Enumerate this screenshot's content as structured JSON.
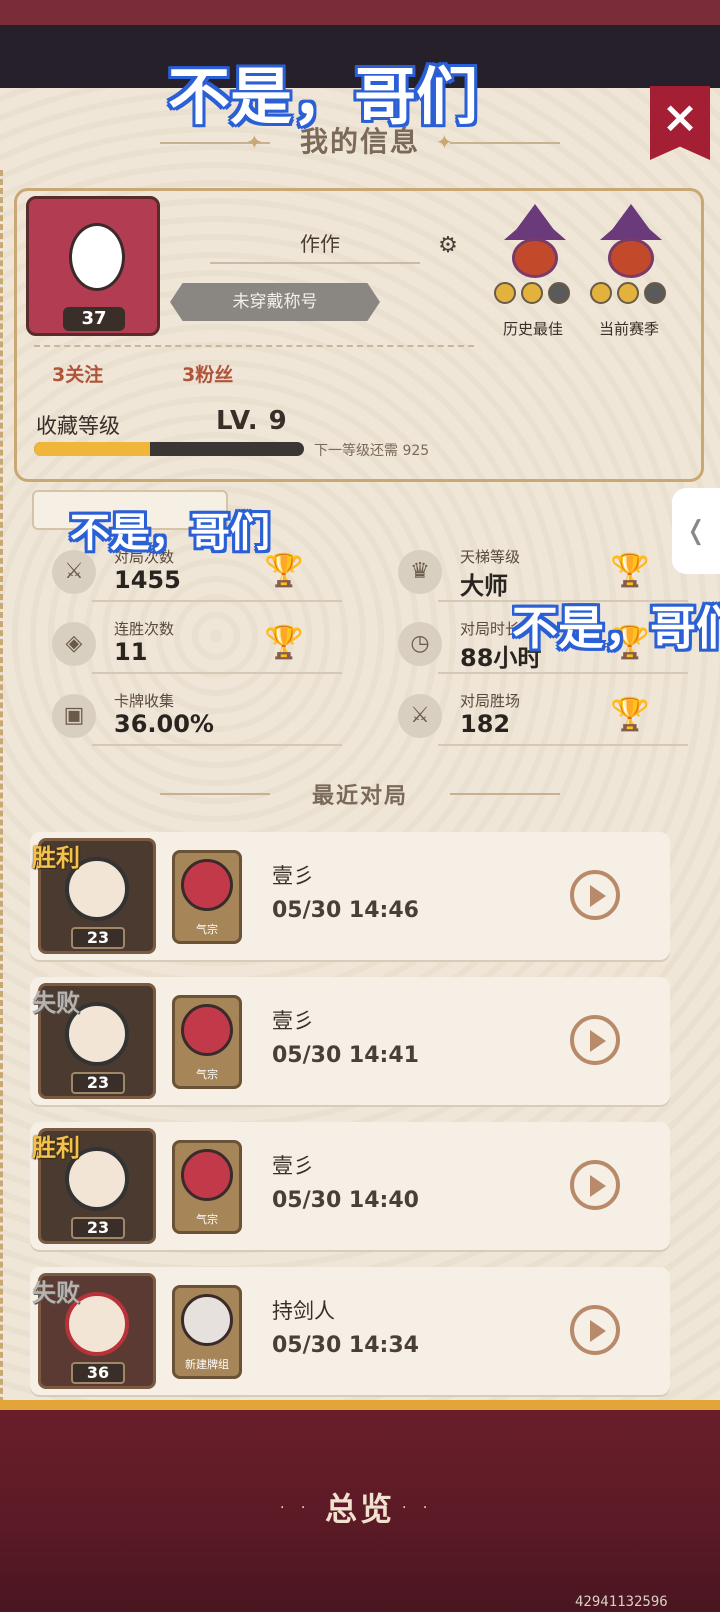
{
  "overlay_text": "不是，哥们",
  "header": {
    "title": "我的信息",
    "close": "×"
  },
  "profile": {
    "avatar_level": "37",
    "name": "作作",
    "title_badge": "未穿戴称号",
    "following": "3关注",
    "followers": "3粉丝",
    "ranks": [
      {
        "label": "历史最佳"
      },
      {
        "label": "当前赛季"
      }
    ],
    "collection_label": "收藏等级",
    "collection_level": "LV. 9",
    "xp_fraction": 0.43,
    "next_level": "下一等级还需 925"
  },
  "stats": [
    {
      "label": "对局次数",
      "value": "1455",
      "icon": "crossed-swords-icon"
    },
    {
      "label": "天梯等级",
      "value": "大师",
      "icon": "crown-icon"
    },
    {
      "label": "连胜次数",
      "value": "11",
      "icon": "streak-icon"
    },
    {
      "label": "对局时长",
      "value": "88小时",
      "icon": "clock-icon"
    },
    {
      "label": "卡牌收集",
      "value": "36.00%",
      "icon": "card-icon"
    },
    {
      "label": "对局胜场",
      "value": "182",
      "icon": "crossed-swords-icon"
    }
  ],
  "recent_title": "最近对局",
  "matches": [
    {
      "result": "胜利",
      "level": "23",
      "deck": "气宗",
      "opponent": "壹彡",
      "time": "05/30 14:46"
    },
    {
      "result": "失败",
      "level": "23",
      "deck": "气宗",
      "opponent": "壹彡",
      "time": "05/30 14:41"
    },
    {
      "result": "胜利",
      "level": "23",
      "deck": "气宗",
      "opponent": "壹彡",
      "time": "05/30 14:40"
    },
    {
      "result": "失败",
      "level": "36",
      "deck": "新建牌组",
      "opponent": "持剑人",
      "time": "05/30 14:34"
    }
  ],
  "bottom": {
    "title": "总览"
  },
  "watermark": "42941132596"
}
